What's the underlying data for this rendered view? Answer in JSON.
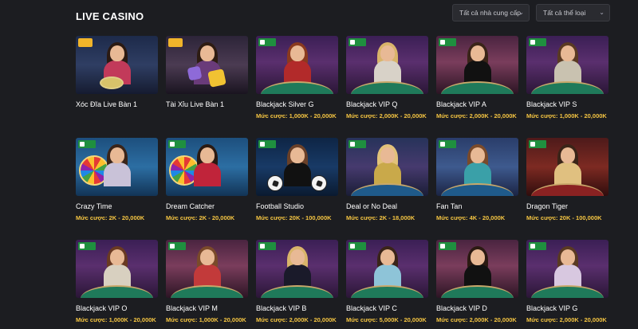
{
  "header": {
    "title": "LIVE CASINO",
    "filter_provider": "Tất cả nhà cung cấp",
    "filter_category": "Tất cả thể loại"
  },
  "games": [
    {
      "title": "Xóc Đĩa Live Bàn 1",
      "bet": "",
      "theme": "xoc",
      "badge": "hot",
      "hair": "#2b1a12",
      "outfit": "#c23a5a"
    },
    {
      "title": "Tài Xỉu Live Bàn 1",
      "bet": "",
      "theme": "taixiu",
      "badge": "hot",
      "hair": "#2e1c12",
      "outfit": "#6a3b7a"
    },
    {
      "title": "Blackjack Silver G",
      "bet": "Mức cược: 1,000K - 20,000K",
      "theme": "bj",
      "badge": "evo",
      "hair": "#8a3a1e",
      "outfit": "#b22a2a"
    },
    {
      "title": "Blackjack VIP Q",
      "bet": "Mức cược: 2,000K - 20,000K",
      "theme": "bj",
      "badge": "evo",
      "hair": "#d9b46a",
      "outfit": "#d8d2c8"
    },
    {
      "title": "Blackjack VIP A",
      "bet": "Mức cược: 2,000K - 20,000K",
      "theme": "bj2",
      "badge": "evo",
      "hair": "#3a2418",
      "outfit": "#111111"
    },
    {
      "title": "Blackjack VIP S",
      "bet": "Mức cược: 1,000K - 20,000K",
      "theme": "bj",
      "badge": "evo",
      "hair": "#5a3a22",
      "outfit": "#c9c2b0"
    },
    {
      "title": "Crazy Time",
      "bet": "Mức cược: 2K - 20,000K",
      "theme": "wheel",
      "badge": "evo",
      "hair": "#3a2418",
      "outfit": "#c9c2d8"
    },
    {
      "title": "Dream Catcher",
      "bet": "Mức cược: 2K - 20,000K",
      "theme": "wheel",
      "badge": "evo",
      "hair": "#2b1a12",
      "outfit": "#c0243a"
    },
    {
      "title": "Football Studio",
      "bet": "Mức cược: 20K - 100,000K",
      "theme": "foot",
      "badge": "evo",
      "hair": "#6a4028",
      "outfit": "#111111"
    },
    {
      "title": "Deal or No Deal",
      "bet": "Mức cược: 2K - 18,000K",
      "theme": "deal",
      "badge": "evo",
      "hair": "#e2c27a",
      "outfit": "#c9a94a"
    },
    {
      "title": "Fan Tan",
      "bet": "Mức cược: 4K - 20,000K",
      "theme": "fan",
      "badge": "evo",
      "hair": "#7a4a2a",
      "outfit": "#3aa0a8"
    },
    {
      "title": "Dragon Tiger",
      "bet": "Mức cược: 20K - 100,000K",
      "theme": "dragon",
      "badge": "evo",
      "hair": "#3a2418",
      "outfit": "#e0c080"
    },
    {
      "title": "Blackjack VIP O",
      "bet": "Mức cược: 1,000K - 20,000K",
      "theme": "bj",
      "badge": "evo",
      "hair": "#6a3a22",
      "outfit": "#d8d0c0"
    },
    {
      "title": "Blackjack VIP M",
      "bet": "Mức cược: 1,000K - 20,000K",
      "theme": "bj2",
      "badge": "evo",
      "hair": "#7a4a2a",
      "outfit": "#c23a3a"
    },
    {
      "title": "Blackjack VIP B",
      "bet": "Mức cược: 2,000K - 20,000K",
      "theme": "bj",
      "badge": "evo",
      "hair": "#d9b46a",
      "outfit": "#1a1a2a"
    },
    {
      "title": "Blackjack VIP C",
      "bet": "Mức cược: 5,000K - 20,000K",
      "theme": "bj",
      "badge": "evo",
      "hair": "#3a2418",
      "outfit": "#8ec4d8"
    },
    {
      "title": "Blackjack VIP D",
      "bet": "Mức cược: 2,000K - 20,000K",
      "theme": "bj2",
      "badge": "evo",
      "hair": "#2b1a12",
      "outfit": "#111111"
    },
    {
      "title": "Blackjack VIP G",
      "bet": "Mức cược: 2,000K - 20,000K",
      "theme": "bj",
      "badge": "evo",
      "hair": "#5a3a22",
      "outfit": "#d8c8e0"
    }
  ],
  "colors": {
    "background": "#1c1d21",
    "bet_text": "#f5c542",
    "provider_badge": "#1f8f3f"
  }
}
